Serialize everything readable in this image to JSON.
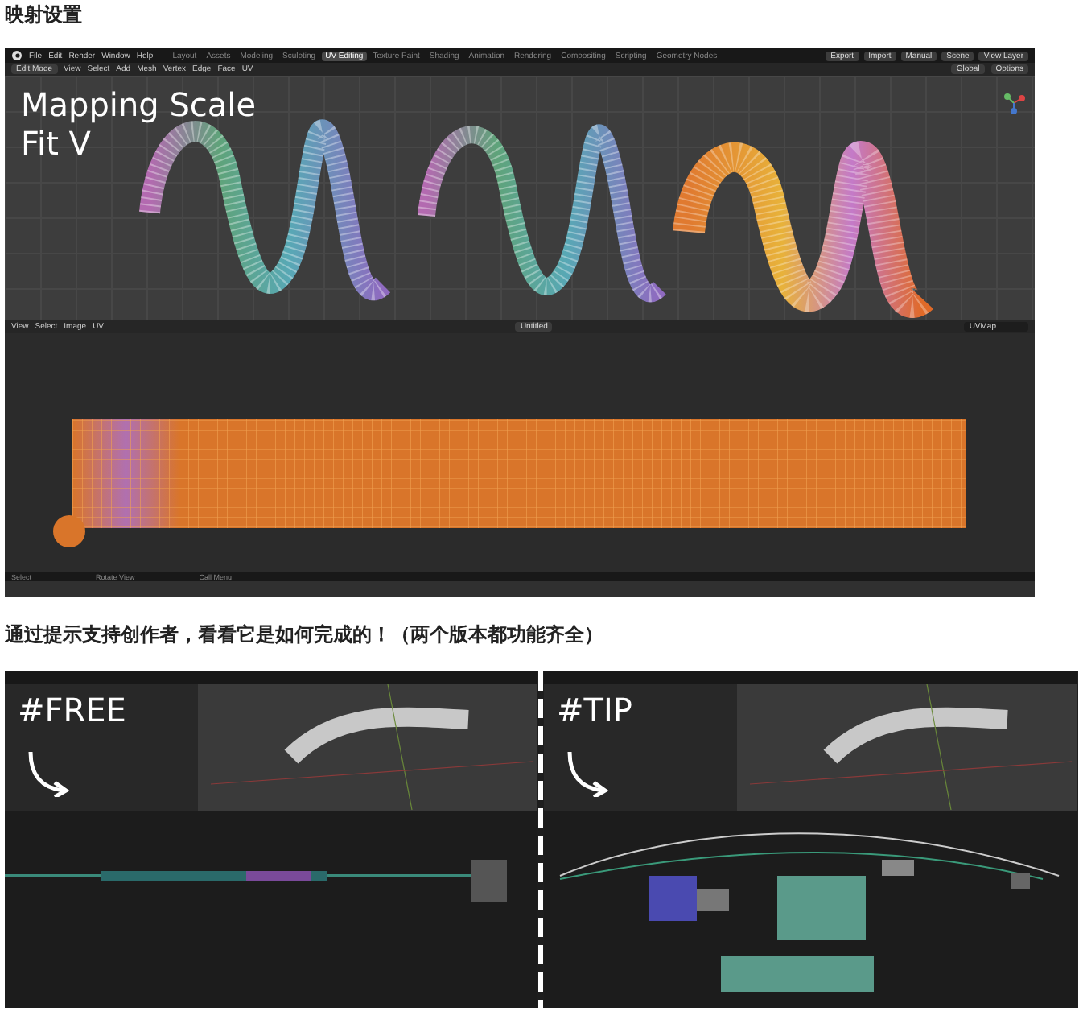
{
  "heading": "映射设置",
  "figure1": {
    "menu": [
      "File",
      "Edit",
      "Render",
      "Window",
      "Help"
    ],
    "workspaces": [
      {
        "label": "Layout",
        "selected": false
      },
      {
        "label": "Assets",
        "selected": false
      },
      {
        "label": "Modeling",
        "selected": false
      },
      {
        "label": "Sculpting",
        "selected": false
      },
      {
        "label": "UV Editing",
        "selected": true
      },
      {
        "label": "Texture Paint",
        "selected": false
      },
      {
        "label": "Shading",
        "selected": false
      },
      {
        "label": "Animation",
        "selected": false
      },
      {
        "label": "Rendering",
        "selected": false
      },
      {
        "label": "Compositing",
        "selected": false
      },
      {
        "label": "Scripting",
        "selected": false
      },
      {
        "label": "Geometry Nodes",
        "selected": false
      }
    ],
    "top_buttons": [
      "Export",
      "Import",
      "Manual"
    ],
    "scene": "Scene",
    "view_layer": "View Layer",
    "mode": "Edit Mode",
    "viewport_menu": [
      "View",
      "Select",
      "Add",
      "Mesh",
      "Vertex",
      "Edge",
      "Face",
      "UV"
    ],
    "orientation": "Global",
    "options": "Options",
    "overlay_title": [
      "Mapping Scale",
      "Fit V"
    ],
    "uv_menu": [
      "View",
      "Select",
      "Image",
      "UV"
    ],
    "image_name": "Untitled",
    "uv_map": "UVMap",
    "status": [
      "Select",
      "Rotate View",
      "Call Menu"
    ]
  },
  "caption": "通过提示支持创作者，看看它是如何完成的！（两个版本都功能齐全）",
  "figure2": {
    "panels": [
      {
        "tag": "#FREE",
        "kind": "free"
      },
      {
        "tag": "#TIP",
        "kind": "tip"
      }
    ]
  }
}
